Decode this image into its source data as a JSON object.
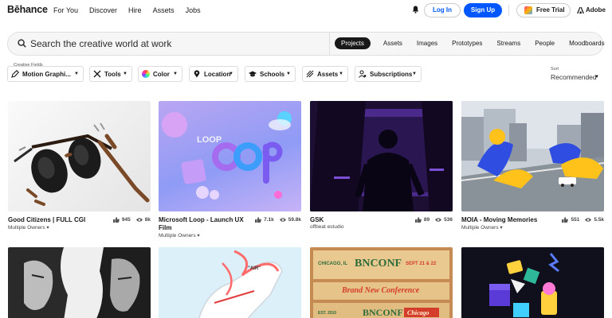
{
  "brand": {
    "logo": "Bēhance"
  },
  "nav": {
    "links": [
      "For You",
      "Discover",
      "Hire",
      "Assets",
      "Jobs"
    ]
  },
  "header": {
    "login": "Log In",
    "signup": "Sign Up",
    "free_trial": "Free Trial",
    "adobe": "Adobe"
  },
  "search": {
    "placeholder": "Search the creative world at work",
    "tabs": [
      "Projects",
      "Assets",
      "Images",
      "Prototypes",
      "Streams",
      "People",
      "Moodboards"
    ],
    "active_tab": "Projects"
  },
  "filters": {
    "creative_fields_label": "Creative Fields",
    "chips": [
      "Motion Graphi...",
      "Tools",
      "Color",
      "Location",
      "Schools",
      "Assets",
      "Subscriptions"
    ]
  },
  "sort": {
    "label": "Sort",
    "value": "Recommended"
  },
  "projects": [
    {
      "title": "Good Citizens | FULL CGI",
      "owner": "Multiple Owners",
      "appreciations": "945",
      "views": "8k"
    },
    {
      "title": "Microsoft Loop - Launch UX Film",
      "owner": "Multiple Owners",
      "appreciations": "7.1k",
      "views": "59.8k"
    },
    {
      "title": "GSK",
      "owner": "offbeat estudio",
      "appreciations": "89",
      "views": "536"
    },
    {
      "title": "MOIA - Moving Memories",
      "owner": "Multiple Owners",
      "appreciations": "551",
      "views": "5.5k"
    }
  ],
  "thumb_text": {
    "loop": "LOOP",
    "air": "\"AIR\"",
    "pizza_city": "CHICAGO, IL",
    "pizza_brand": "BNCONF",
    "pizza_date": "SEPT 21 & 22",
    "pizza_tag": "Brand New Conference",
    "pizza_est": "EST. 2010",
    "pizza_brand2": "BNCONF",
    "pizza_chicago": "Chicago"
  },
  "colors": {
    "accent": "#0057ff",
    "text": "#191919",
    "active_tab_bg": "#191919"
  }
}
